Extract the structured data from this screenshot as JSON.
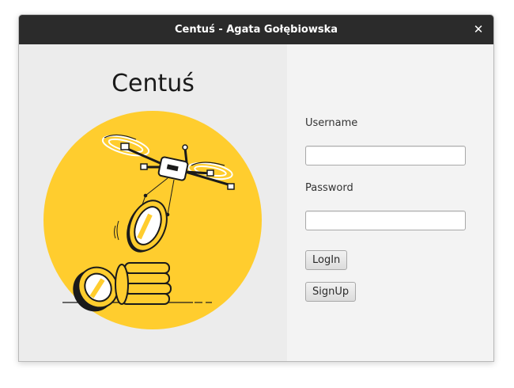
{
  "window": {
    "title": "Centuś - Agata Gołębiowska",
    "close_symbol": "✕"
  },
  "brand": {
    "app_name": "Centuś",
    "illustration": "drone-carrying-coin-icon",
    "colors": {
      "accent": "#FFCD2E",
      "titlebar": "#2B2B2B"
    }
  },
  "form": {
    "username_label": "Username",
    "username_value": "",
    "password_label": "Password",
    "password_value": "",
    "login_button": "LogIn",
    "signup_button": "SignUp"
  }
}
